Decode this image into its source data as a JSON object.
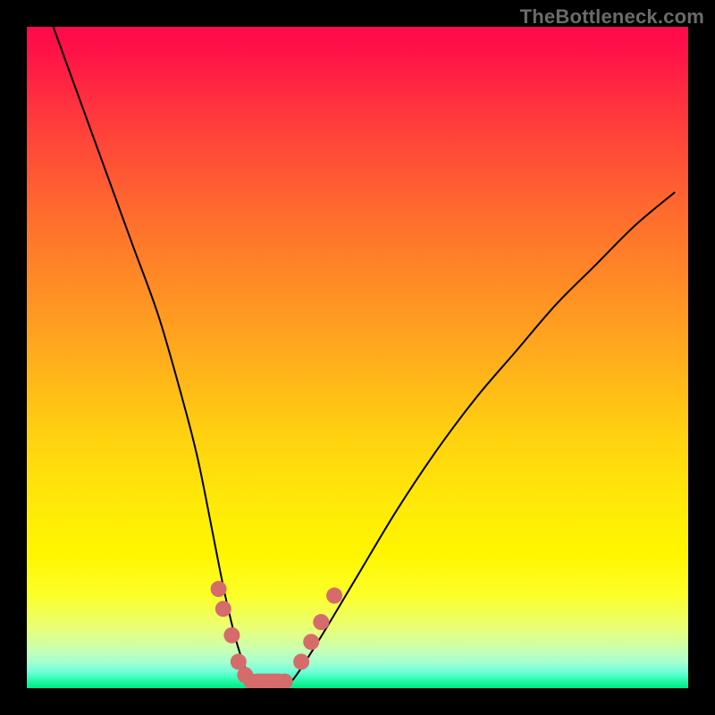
{
  "watermark": "TheBottleneck.com",
  "colors": {
    "frame": "#000000",
    "gradient_top": "#ff0a4a",
    "gradient_bottom": "#00e884",
    "curve": "#000000",
    "marker": "#d66b6b",
    "watermark": "#6b6b6b"
  },
  "chart_data": {
    "type": "line",
    "title": "",
    "xlabel": "",
    "ylabel": "",
    "xlim": [
      0,
      100
    ],
    "ylim": [
      0,
      100
    ],
    "grid": false,
    "series": [
      {
        "name": "bottleneck-curve",
        "x": [
          4,
          8,
          12,
          16,
          20,
          24,
          26,
          28,
          30,
          32,
          34,
          36,
          38,
          40,
          44,
          50,
          56,
          62,
          68,
          74,
          80,
          86,
          92,
          98
        ],
        "y": [
          100,
          89,
          78,
          67,
          56,
          42,
          34,
          24,
          14,
          6,
          1,
          0,
          0,
          1,
          7,
          17,
          27,
          36,
          44,
          51,
          58,
          64,
          70,
          75
        ]
      }
    ],
    "markers": [
      {
        "x": 29.0,
        "y": 15
      },
      {
        "x": 29.7,
        "y": 12
      },
      {
        "x": 31.0,
        "y": 8
      },
      {
        "x": 32.0,
        "y": 4
      },
      {
        "x": 33.0,
        "y": 2
      },
      {
        "x": 34.0,
        "y": 1
      },
      {
        "x": 35.0,
        "y": 0.3
      },
      {
        "x": 36.0,
        "y": 0
      },
      {
        "x": 37.0,
        "y": 0
      },
      {
        "x": 38.0,
        "y": 0.3
      },
      {
        "x": 39.0,
        "y": 1
      },
      {
        "x": 41.5,
        "y": 4
      },
      {
        "x": 43.0,
        "y": 7
      },
      {
        "x": 44.5,
        "y": 10
      },
      {
        "x": 46.5,
        "y": 14
      }
    ],
    "legend": false
  }
}
